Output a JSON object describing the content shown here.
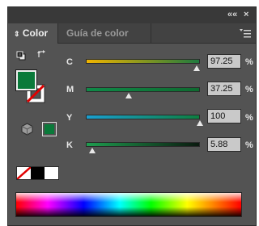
{
  "window": {
    "collapse_glyph": "««",
    "close_glyph": "×"
  },
  "tabs": {
    "active": {
      "label": "Color",
      "icon": "updown-arrows-icon"
    },
    "inactive": {
      "label": "Guía de color"
    },
    "menu_icon": "panel-menu-icon"
  },
  "colors": {
    "fill": "#0a7a3a",
    "swatch_white": "#ffffff",
    "swatch_black": "#000000",
    "slider_C": [
      "#f0b400",
      "#1f7a3f"
    ],
    "slider_M": [
      "#0f8a48",
      "#0f6a30"
    ],
    "slider_Y": [
      "#1a9fd0",
      "#0e7f40"
    ],
    "slider_K": [
      "#1f9d4f",
      "#0a1a0f"
    ]
  },
  "channels": [
    {
      "name": "C",
      "value": "97.25",
      "unit": "%"
    },
    {
      "name": "M",
      "value": "37.25",
      "unit": "%"
    },
    {
      "name": "Y",
      "value": "100",
      "unit": "%"
    },
    {
      "name": "K",
      "value": "5.88",
      "unit": "%"
    }
  ],
  "channel_levels": [
    0.9725,
    0.3725,
    1.0,
    0.0588
  ]
}
